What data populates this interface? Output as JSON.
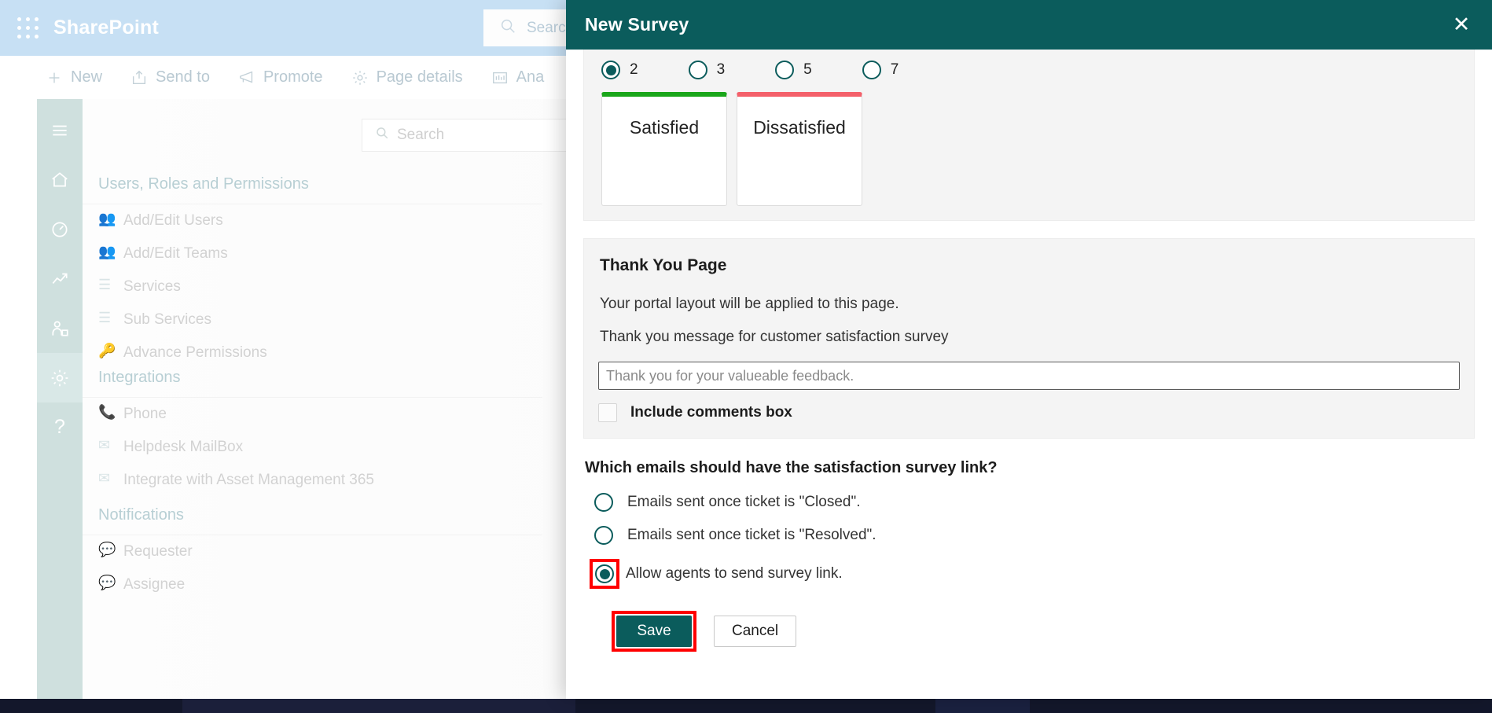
{
  "background": {
    "topbar": {
      "app_title": "SharePoint",
      "waffle_icon": "app-launcher-icon",
      "search_placeholder": "Search"
    },
    "commandbar": [
      {
        "icon": "plus-icon",
        "label": "New"
      },
      {
        "icon": "share-icon",
        "label": "Send to"
      },
      {
        "icon": "megaphone-icon",
        "label": "Promote"
      },
      {
        "icon": "gear-icon",
        "label": "Page details"
      },
      {
        "icon": "chart-icon",
        "label": "Ana"
      }
    ],
    "rail": [
      {
        "icon": "hamburger-icon",
        "name": "menu"
      },
      {
        "icon": "home-icon",
        "name": "home"
      },
      {
        "icon": "dashboard-icon",
        "name": "dashboard"
      },
      {
        "icon": "trending-icon",
        "name": "reports"
      },
      {
        "icon": "agents-icon",
        "name": "agents"
      },
      {
        "icon": "gear-icon",
        "name": "settings"
      },
      {
        "icon": "question-icon",
        "name": "help"
      }
    ],
    "inner_search_placeholder": "Search",
    "sections": [
      {
        "title": "Users, Roles and Permissions",
        "items": [
          {
            "icon": "users-icon",
            "label": "Add/Edit Users"
          },
          {
            "icon": "teams-icon",
            "label": "Add/Edit Teams"
          },
          {
            "icon": "list-icon",
            "label": "Services"
          },
          {
            "icon": "sublist-icon",
            "label": "Sub Services"
          },
          {
            "icon": "key-icon",
            "label": "Advance Permissions"
          }
        ]
      },
      {
        "title": "Integrations",
        "items": [
          {
            "icon": "phone-icon",
            "label": "Phone"
          },
          {
            "icon": "mail-icon",
            "label": "Helpdesk MailBox"
          },
          {
            "icon": "mail-gear-icon",
            "label": "Integrate with Asset Management 365"
          }
        ]
      },
      {
        "title": "Notifications",
        "items": [
          {
            "icon": "comment-alert-icon",
            "label": "Requester"
          },
          {
            "icon": "comment-alert-icon",
            "label": "Assignee"
          }
        ]
      }
    ]
  },
  "modal": {
    "title": "New Survey",
    "close_icon": "close-icon",
    "scale": {
      "options": [
        {
          "value": "2",
          "selected": true
        },
        {
          "value": "3",
          "selected": false
        },
        {
          "value": "5",
          "selected": false
        },
        {
          "value": "7",
          "selected": false
        }
      ]
    },
    "rating_cards": [
      {
        "label": "Satisfied",
        "accent": "#1aa61a"
      },
      {
        "label": "Dissatisfied",
        "accent": "#f4606a"
      }
    ],
    "thank_you": {
      "heading": "Thank You Page",
      "note": "Your portal layout will be applied to this page.",
      "message_label": "Thank you message for customer satisfaction survey",
      "input_value": "",
      "input_placeholder": "Thank you for your valueable feedback.",
      "comments_checkbox_label": "Include comments box",
      "comments_checked": false
    },
    "email_question": {
      "title": "Which emails should have the satisfaction survey link?",
      "options": [
        {
          "label": "Emails sent once ticket is \"Closed\".",
          "selected": false,
          "highlighted": false
        },
        {
          "label": "Emails sent once ticket is \"Resolved\".",
          "selected": false,
          "highlighted": false
        },
        {
          "label": "Allow agents to send survey link.",
          "selected": true,
          "highlighted": true
        }
      ]
    },
    "footer": {
      "save_label": "Save",
      "save_highlighted": true,
      "cancel_label": "Cancel"
    }
  },
  "colors": {
    "teal": "#0b5c5c",
    "sharepoint_blue": "#c7e0f4",
    "highlight_red": "#ff0000",
    "green": "#1aa61a",
    "red": "#f4606a"
  }
}
